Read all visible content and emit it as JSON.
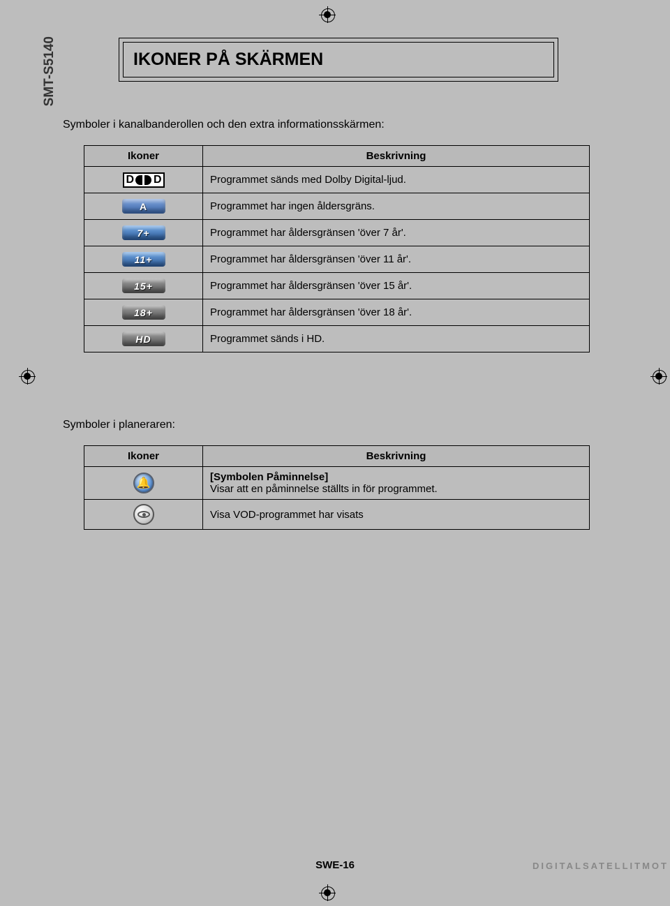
{
  "model": "SMT-S5140",
  "title": "IKONER PÅ SKÄRMEN",
  "intro1": "Symboler i kanalbanderollen och den extra informationsskärmen:",
  "table1": {
    "head_icon": "Ikoner",
    "head_desc": "Beskrivning",
    "rows": [
      {
        "icon": "dolby",
        "label": "",
        "desc": "Programmet sänds med Dolby Digital-ljud."
      },
      {
        "icon": "badge-a",
        "label": "A",
        "desc": "Programmet har ingen åldersgräns."
      },
      {
        "icon": "badge-blue",
        "label": "7+",
        "desc": "Programmet har åldersgränsen 'över 7 år'."
      },
      {
        "icon": "badge-blue",
        "label": "11+",
        "desc": "Programmet har åldersgränsen 'över 11 år'."
      },
      {
        "icon": "badge-gray",
        "label": "15+",
        "desc": "Programmet har åldersgränsen 'över 15 år'."
      },
      {
        "icon": "badge-gray",
        "label": "18+",
        "desc": "Programmet har åldersgränsen 'över 18 år'."
      },
      {
        "icon": "badge-gray",
        "label": "HD",
        "desc": "Programmet sänds i HD."
      }
    ]
  },
  "intro2": "Symboler i planeraren:",
  "table2": {
    "head_icon": "Ikoner",
    "head_desc": "Beskrivning",
    "rows": [
      {
        "icon": "reminder",
        "bold": "[Symbolen Påminnelse]",
        "desc": "Visar att en påminnelse ställts in för programmet."
      },
      {
        "icon": "vod",
        "desc": "Visa VOD-programmet har visats"
      }
    ]
  },
  "footer_page": "SWE-16",
  "footer_right": "DIGITALSATELLITMOT"
}
